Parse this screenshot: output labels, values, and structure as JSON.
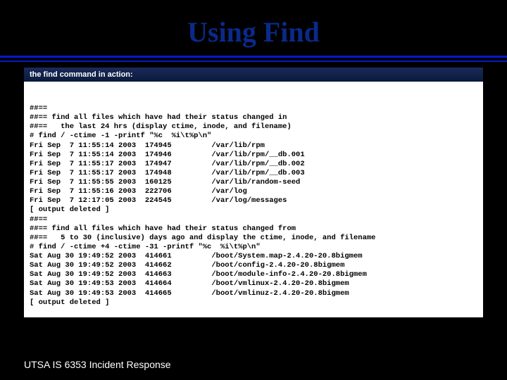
{
  "title": "Using Find",
  "subtitle": "the find command in action:",
  "terminal": {
    "lines": [
      "##==",
      "##== find all files which have had their status changed in",
      "##==   the last 24 hrs (display ctime, inode, and filename)",
      "# find / -ctime -1 -printf \"%c  %i\\t%p\\n\"",
      "Fri Sep  7 11:55:14 2003  174945         /var/lib/rpm",
      "Fri Sep  7 11:55:14 2003  174946         /var/lib/rpm/__db.001",
      "Fri Sep  7 11:55:17 2003  174947         /var/lib/rpm/__db.002",
      "Fri Sep  7 11:55:17 2003  174948         /var/lib/rpm/__db.003",
      "Fri Sep  7 11:55:55 2003  160125         /var/lib/random-seed",
      "Fri Sep  7 11:55:16 2003  222706         /var/log",
      "Fri Sep  7 12:17:05 2003  224545         /var/log/messages",
      "[ output deleted ]",
      "##==",
      "##== find all files which have had their status changed from",
      "##==   5 to 30 (inclusive) days ago and display the ctime, inode, and filename",
      "# find / -ctime +4 -ctime -31 -printf \"%c  %i\\t%p\\n\"",
      "Sat Aug 30 19:49:52 2003  414661         /boot/System.map-2.4.20-20.8bigmem",
      "Sat Aug 30 19:49:52 2003  414662         /boot/config-2.4.20-20.8bigmem",
      "Sat Aug 30 19:49:52 2003  414663         /boot/module-info-2.4.20-20.8bigmem",
      "Sat Aug 30 19:49:53 2003  414664         /boot/vmlinux-2.4.20-20.8bigmem",
      "Sat Aug 30 19:49:53 2003  414665         /boot/vmlinuz-2.4.20-20.8bigmem",
      "[ output deleted ]"
    ]
  },
  "footer": "UTSA IS 6353 Incident Response"
}
